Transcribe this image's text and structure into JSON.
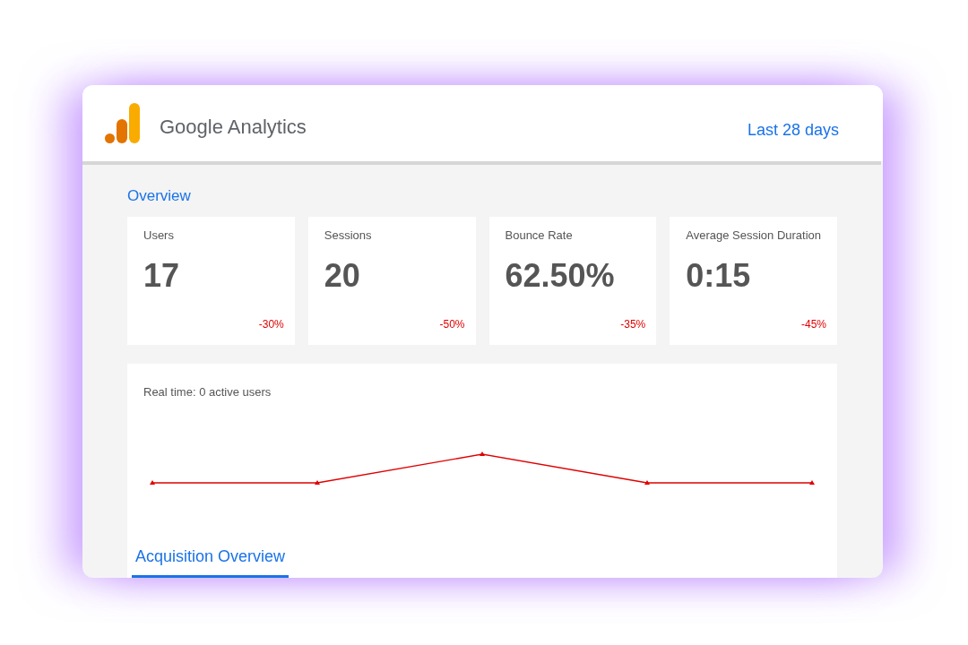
{
  "header": {
    "brand": "Google Analytics",
    "date_range": "Last 28 days"
  },
  "overview": {
    "title": "Overview",
    "metrics": [
      {
        "label": "Users",
        "value": "17",
        "change": "-30%"
      },
      {
        "label": "Sessions",
        "value": "20",
        "change": "-50%"
      },
      {
        "label": "Bounce Rate",
        "value": "62.50%",
        "change": "-35%"
      },
      {
        "label": "Average Session Duration",
        "value": "0:15",
        "change": "-45%"
      }
    ]
  },
  "realtime": {
    "title": "Real time: 0 active users"
  },
  "tabs": [
    {
      "label": "Acquisition Overview",
      "selected": true
    }
  ]
}
